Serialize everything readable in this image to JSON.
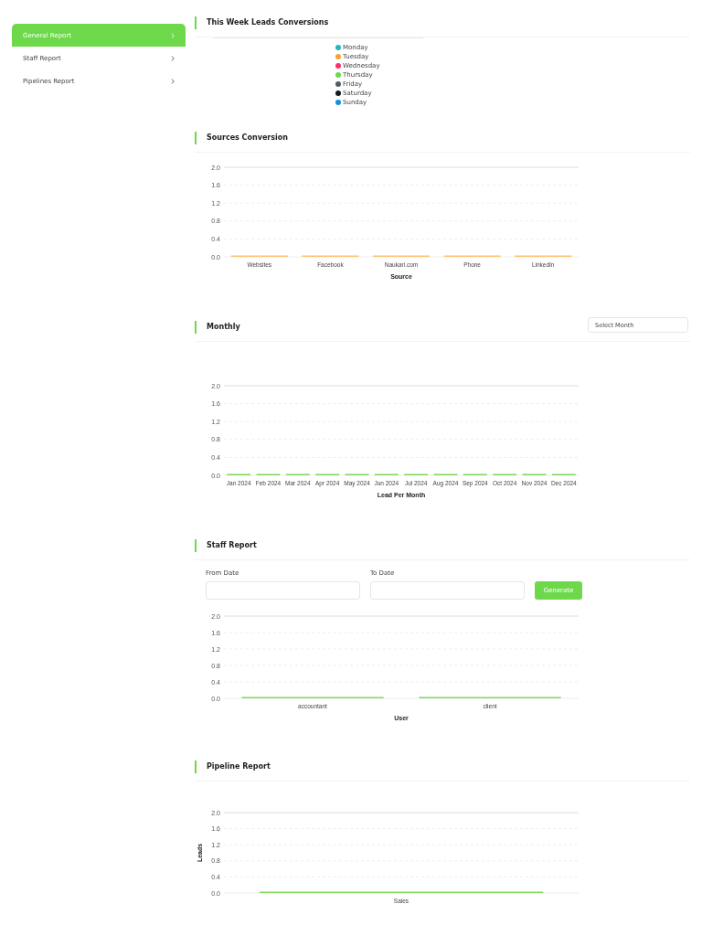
{
  "sidebar": {
    "items": [
      {
        "label": "General Report",
        "selected": true
      },
      {
        "label": "Staff Report",
        "selected": false
      },
      {
        "label": "Pipelines Report",
        "selected": false
      }
    ]
  },
  "sections": [
    {
      "kind": "legend",
      "title": "This Week Leads Conversions",
      "legend": [
        {
          "label": "Monday",
          "color": "#26b5c0"
        },
        {
          "label": "Tuesday",
          "color": "#ff9f2e"
        },
        {
          "label": "Wednesday",
          "color": "#ff2d6e"
        },
        {
          "label": "Thursday",
          "color": "#6dd94a"
        },
        {
          "label": "Friday",
          "color": "#555b66"
        },
        {
          "label": "Saturday",
          "color": "#111827"
        },
        {
          "label": "Sunday",
          "color": "#1090e0"
        }
      ]
    },
    {
      "kind": "chart",
      "title": "Sources Conversion",
      "chart_data": {
        "type": "bar",
        "xlabel": "Source",
        "categories": [
          "Websites",
          "Facebook",
          "Naukari.com",
          "Phone",
          "LinkedIn"
        ],
        "grid": true,
        "series": [
          {
            "color": "#ffc36e",
            "values": [
              0,
              0,
              0,
              0,
              0
            ]
          }
        ],
        "ylim": [
          0,
          2
        ],
        "yticks": [
          {
            "value": 0,
            "label": "0.0"
          },
          {
            "value": 0.4,
            "label": "0.4"
          },
          {
            "value": 0.8,
            "label": "0.8"
          },
          {
            "value": 1.2,
            "label": "1.2"
          },
          {
            "value": 1.6,
            "label": "1.6"
          },
          {
            "value": 2,
            "label": "2.0"
          }
        ]
      }
    },
    {
      "kind": "chart",
      "title": "Monthly",
      "select": "Select Month",
      "chart_data": {
        "type": "bar",
        "xlabel": "Lead Per Month",
        "categories": [
          "Jan 2024",
          "Feb 2024",
          "Mar 2024",
          "Apr 2024",
          "May 2024",
          "Jun 2024",
          "Jul 2024",
          "Aug 2024",
          "Sep 2024",
          "Oct 2024",
          "Nov 2024",
          "Dec 2024"
        ],
        "grid": true,
        "series": [
          {
            "color": "#7ed957",
            "values": [
              0,
              0,
              0,
              0,
              0,
              0,
              0,
              0,
              0,
              0,
              0,
              0
            ]
          }
        ],
        "ylim": [
          0,
          2
        ],
        "yticks": [
          {
            "value": 0,
            "label": "0.0"
          },
          {
            "value": 0.4,
            "label": "0.4"
          },
          {
            "value": 0.8,
            "label": "0.8"
          },
          {
            "value": 1.2,
            "label": "1.2"
          },
          {
            "value": 1.6,
            "label": "1.6"
          },
          {
            "value": 2,
            "label": "2.0"
          }
        ]
      }
    },
    {
      "kind": "form-chart",
      "title": "Staff Report",
      "fields": [
        {
          "label": "From Date"
        },
        {
          "label": "To Date"
        }
      ],
      "button": "Generate",
      "chart_data": {
        "type": "bar",
        "xlabel": "User",
        "categories": [
          "accountant",
          "client"
        ],
        "grid": true,
        "series": [
          {
            "color": "#7ed957",
            "values": [
              0,
              0
            ]
          }
        ],
        "ylim": [
          0,
          2
        ],
        "yticks": [
          {
            "value": 0,
            "label": "0.0"
          },
          {
            "value": 0.4,
            "label": "0.4"
          },
          {
            "value": 0.8,
            "label": "0.8"
          },
          {
            "value": 1.2,
            "label": "1.2"
          },
          {
            "value": 1.6,
            "label": "1.6"
          },
          {
            "value": 2,
            "label": "2.0"
          }
        ]
      }
    },
    {
      "kind": "chart",
      "title": "Pipeline Report",
      "chart_data": {
        "type": "bar",
        "ylabel": "Leads",
        "categories": [
          "Sales"
        ],
        "grid": true,
        "series": [
          {
            "color": "#7ed957",
            "values": [
              0
            ]
          }
        ],
        "ylim": [
          0,
          2
        ],
        "yticks": [
          {
            "value": 0,
            "label": "0.0"
          },
          {
            "value": 0.4,
            "label": "0.4"
          },
          {
            "value": 0.8,
            "label": "0.8"
          },
          {
            "value": 1.2,
            "label": "1.2"
          },
          {
            "value": 1.6,
            "label": "1.6"
          },
          {
            "value": 2,
            "label": "2.0"
          }
        ]
      }
    }
  ]
}
